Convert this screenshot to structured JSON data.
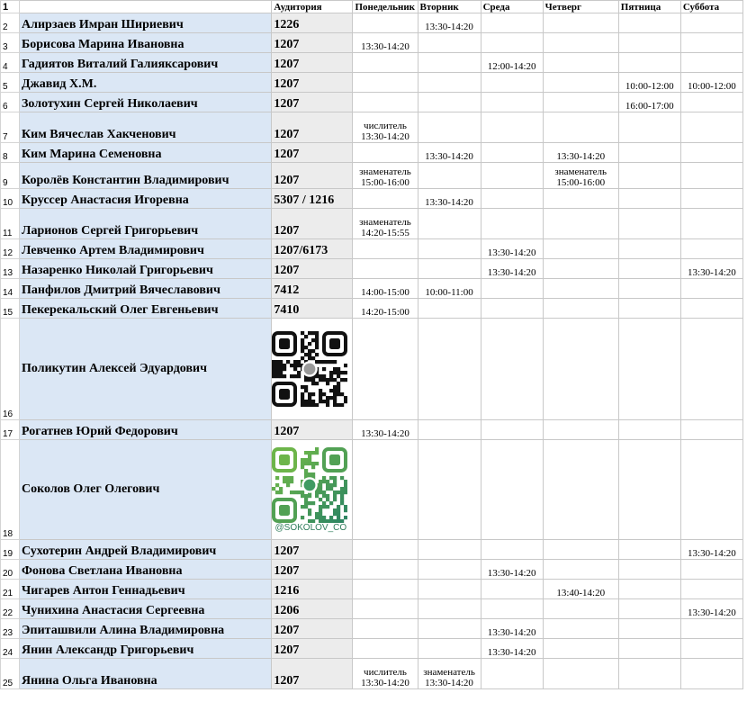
{
  "headers": {
    "row_number": "1",
    "name": "",
    "auditorium": "Аудитория",
    "days": [
      "Понедельник",
      "Вторник",
      "Среда",
      "Четверг",
      "Пятница",
      "Суббота"
    ]
  },
  "rows": [
    {
      "n": "2",
      "name": "Алирзаев Имран Шириевич",
      "aud": "1226",
      "days": [
        "",
        "13:30-14:20",
        "",
        "",
        "",
        ""
      ]
    },
    {
      "n": "3",
      "name": "Борисова Марина Ивановна",
      "aud": "1207",
      "days": [
        "13:30-14:20",
        "",
        "",
        "",
        "",
        ""
      ]
    },
    {
      "n": "4",
      "name": "Гадиятов Виталий Галияксарович",
      "aud": "1207",
      "days": [
        "",
        "",
        "12:00-14:20",
        "",
        "",
        ""
      ]
    },
    {
      "n": "5",
      "name": "Джавид Х.М.",
      "aud": "1207",
      "days": [
        "",
        "",
        "",
        "",
        "10:00-12:00",
        "10:00-12:00"
      ]
    },
    {
      "n": "6",
      "name": "Золотухин Сергей Николаевич",
      "aud": "1207",
      "days": [
        "",
        "",
        "",
        "",
        "16:00-17:00",
        ""
      ]
    },
    {
      "n": "7",
      "name": "Ким Вячеслав Хакченович",
      "aud": "1207",
      "days": [
        "числитель\n13:30-14:20",
        "",
        "",
        "",
        "",
        ""
      ]
    },
    {
      "n": "8",
      "name": "Ким Марина Семеновна",
      "aud": "1207",
      "days": [
        "",
        "13:30-14:20",
        "",
        "13:30-14:20",
        "",
        ""
      ]
    },
    {
      "n": "9",
      "name": "Королёв Константин Владимирович",
      "aud": "1207",
      "days": [
        "знаменатель\n15:00-16:00",
        "",
        "",
        "знаменатель\n15:00-16:00",
        "",
        ""
      ]
    },
    {
      "n": "10",
      "name": "Круссер Анастасия Игоревна",
      "aud": "5307 / 1216",
      "days": [
        "",
        "13:30-14:20",
        "",
        "",
        "",
        ""
      ]
    },
    {
      "n": "11",
      "name": "Ларионов Сергей Григорьевич",
      "aud": "1207",
      "days": [
        "знаменатель\n14:20-15:55",
        "",
        "",
        "",
        "",
        ""
      ]
    },
    {
      "n": "12",
      "name": "Левченко Артем Владимирович",
      "aud": "1207/6173",
      "days": [
        "",
        "",
        "13:30-14:20",
        "",
        "",
        ""
      ]
    },
    {
      "n": "13",
      "name": "Назаренко Николай Григорьевич",
      "aud": "1207",
      "days": [
        "",
        "",
        "13:30-14:20",
        "",
        "",
        "13:30-14:20"
      ]
    },
    {
      "n": "14",
      "name": "Панфилов Дмитрий Вячеславович",
      "aud": "7412",
      "days": [
        "14:00-15:00",
        "10:00-11:00",
        "",
        "",
        "",
        ""
      ]
    },
    {
      "n": "15",
      "name": "Пекерекальский Олег Евгеньевич",
      "aud": "7410",
      "days": [
        "14:20-15:00",
        "",
        "",
        "",
        "",
        ""
      ]
    },
    {
      "n": "16",
      "name": "Поликутин Алексей Эдуардович",
      "aud": "",
      "qr": "dark",
      "days": [
        "",
        "",
        "",
        "",
        "",
        ""
      ]
    },
    {
      "n": "17",
      "name": "Рогатнев Юрий Федорович",
      "aud": "1207",
      "days": [
        "13:30-14:20",
        "",
        "",
        "",
        "",
        ""
      ]
    },
    {
      "n": "18",
      "name": "Соколов Олег Олегович",
      "aud": "",
      "qr": "green",
      "qr_handle": "@SOKOLOV_CO",
      "days": [
        "",
        "",
        "",
        "",
        "",
        ""
      ]
    },
    {
      "n": "19",
      "name": "Сухотерин Андрей Владимирович",
      "aud": "1207",
      "days": [
        "",
        "",
        "",
        "",
        "",
        "13:30-14:20"
      ]
    },
    {
      "n": "20",
      "name": "Фонова Светлана Ивановна",
      "aud": "1207",
      "days": [
        "",
        "",
        "13:30-14:20",
        "",
        "",
        ""
      ]
    },
    {
      "n": "21",
      "name": "Чигарев Антон Геннадьевич",
      "aud": "1216",
      "days": [
        "",
        "",
        "",
        "13:40-14:20",
        "",
        ""
      ]
    },
    {
      "n": "22",
      "name": "Чунихина Анастасия Сергеевна",
      "aud": "1206",
      "days": [
        "",
        "",
        "",
        "",
        "",
        "13:30-14:20"
      ]
    },
    {
      "n": "23",
      "name": "Эпиташвили Алина Владимировна",
      "aud": "1207",
      "days": [
        "",
        "",
        "13:30-14:20",
        "",
        "",
        ""
      ]
    },
    {
      "n": "24",
      "name": "Янин Александр Григорьевич",
      "aud": "1207",
      "days": [
        "",
        "",
        "13:30-14:20",
        "",
        "",
        ""
      ]
    },
    {
      "n": "25",
      "name": "Янина Ольга Ивановна",
      "aud": "1207",
      "days": [
        "числитель\n13:30-14:20",
        "знаменатель\n13:30-14:20",
        "",
        "",
        "",
        ""
      ]
    }
  ],
  "colors": {
    "name_fill": "#dbe7f5",
    "aud_fill": "#ececec",
    "grid": "#c8c8c8",
    "qr_green": "#3f9a63"
  },
  "icons": {
    "qr_dark": "qr-code-icon",
    "qr_green": "qr-code-icon"
  }
}
